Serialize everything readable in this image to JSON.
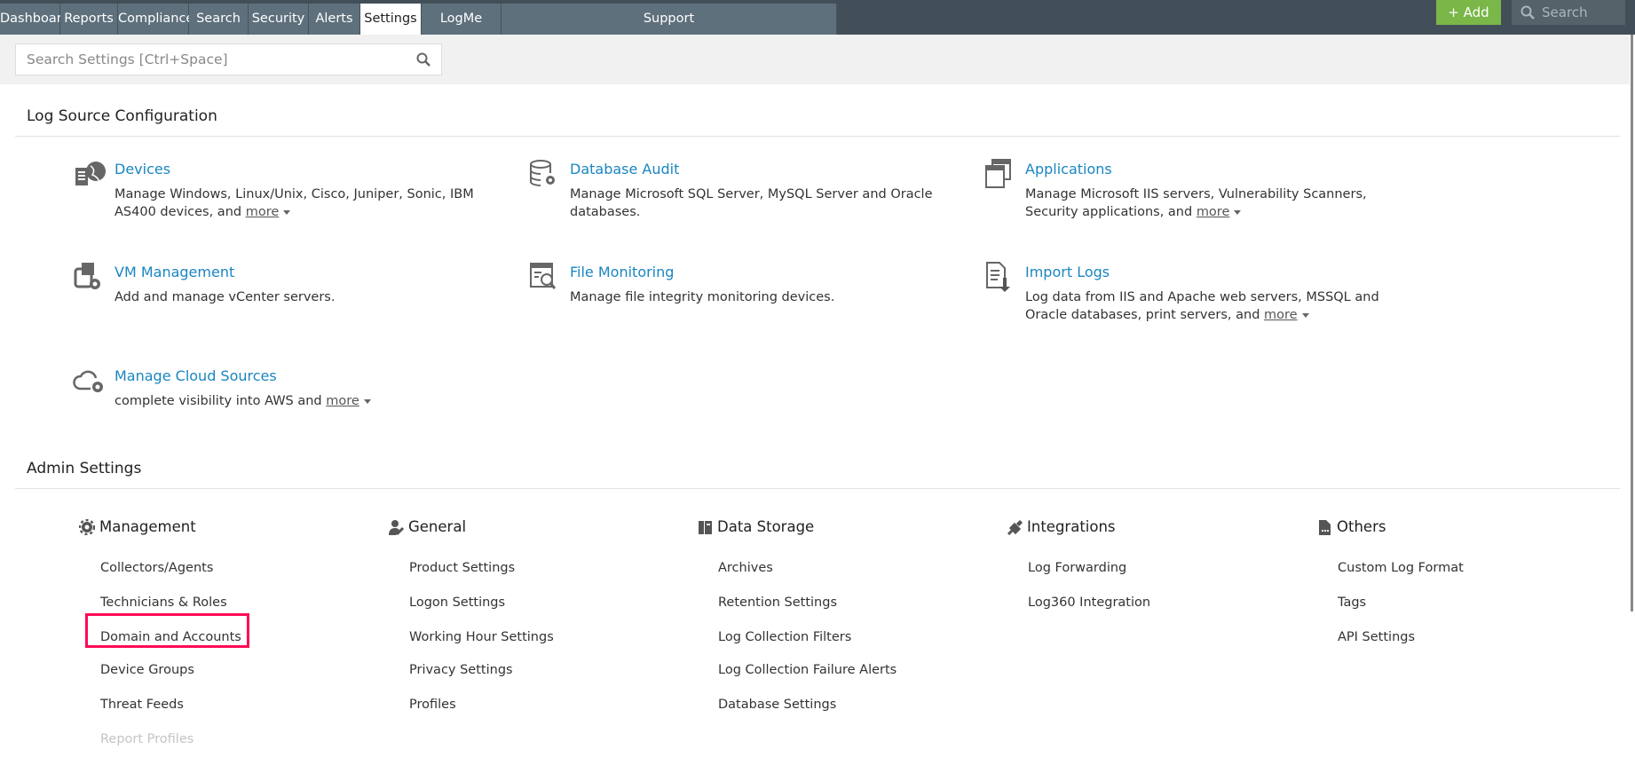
{
  "nav": {
    "tabs": [
      "Dashboard",
      "Reports",
      "Compliance",
      "Search",
      "Security",
      "Alerts",
      "Settings",
      "LogMe",
      "Support"
    ],
    "active": "Settings",
    "add_label": "Add",
    "search_placeholder": "Search"
  },
  "settings_search": {
    "placeholder": "Search Settings [Ctrl+Space]"
  },
  "log_source": {
    "title": "Log Source Configuration",
    "more_label": "more",
    "cards": [
      {
        "title": "Devices",
        "desc": "Manage Windows, Linux/Unix, Cisco, Juniper, Sonic, IBM AS400 devices, and",
        "more": true,
        "icon": "devices-globe-icon"
      },
      {
        "title": "Database Audit",
        "desc": "Manage Microsoft SQL Server, MySQL Server and Oracle databases.",
        "more": false,
        "icon": "database-gear-icon"
      },
      {
        "title": "Applications",
        "desc": "Manage Microsoft IIS servers, Vulnerability Scanners, Security applications, and",
        "more": true,
        "icon": "applications-windows-icon"
      },
      {
        "title": "VM Management",
        "desc": "Add and manage vCenter servers.",
        "more": false,
        "icon": "vm-gear-icon"
      },
      {
        "title": "File Monitoring",
        "desc": "Manage file integrity monitoring devices.",
        "more": false,
        "icon": "file-search-icon"
      },
      {
        "title": "Import Logs",
        "desc": "Log data from IIS and Apache web servers, MSSQL and Oracle databases, print servers, and",
        "more": true,
        "icon": "import-document-icon"
      },
      {
        "title": "Manage Cloud Sources",
        "desc": "complete visibility into AWS and",
        "more": true,
        "icon": "cloud-gear-icon"
      }
    ]
  },
  "admin": {
    "title": "Admin Settings",
    "columns": [
      {
        "title": "Management",
        "icon": "gear-icon",
        "items": [
          "Collectors/Agents",
          "Technicians & Roles",
          "Domain and Accounts",
          "Device Groups",
          "Threat Feeds",
          "Report Profiles"
        ]
      },
      {
        "title": "General",
        "icon": "user-wrench-icon",
        "items": [
          "Product Settings",
          "Logon Settings",
          "Working Hour Settings",
          "Privacy Settings",
          "Profiles"
        ]
      },
      {
        "title": "Data Storage",
        "icon": "storage-icon",
        "items": [
          "Archives",
          "Retention Settings",
          "Log Collection Filters",
          "Log Collection Failure Alerts",
          "Database Settings"
        ]
      },
      {
        "title": "Integrations",
        "icon": "plug-icon",
        "items": [
          "Log Forwarding",
          "Log360 Integration"
        ]
      },
      {
        "title": "Others",
        "icon": "document-icon",
        "items": [
          "Custom Log Format",
          "Tags",
          "API Settings"
        ]
      }
    ],
    "disabled_item": "Report Profiles",
    "highlighted_item": "Domain and Accounts"
  },
  "colors": {
    "accent": "#1a86c0",
    "add": "#7ab648",
    "highlight": "#ff0a55",
    "nav": "#434f58"
  }
}
